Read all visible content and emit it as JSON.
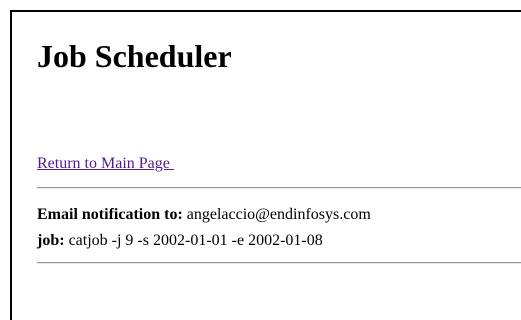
{
  "page": {
    "title": "Job Scheduler",
    "return_link": "Return to Main Page "
  },
  "details": {
    "email_label": "Email notification to:",
    "email_value": "angelaccio@endinfosys.com",
    "job_label": "job:",
    "job_value": "catjob -j 9 -s 2002-01-01 -e 2002-01-08"
  }
}
